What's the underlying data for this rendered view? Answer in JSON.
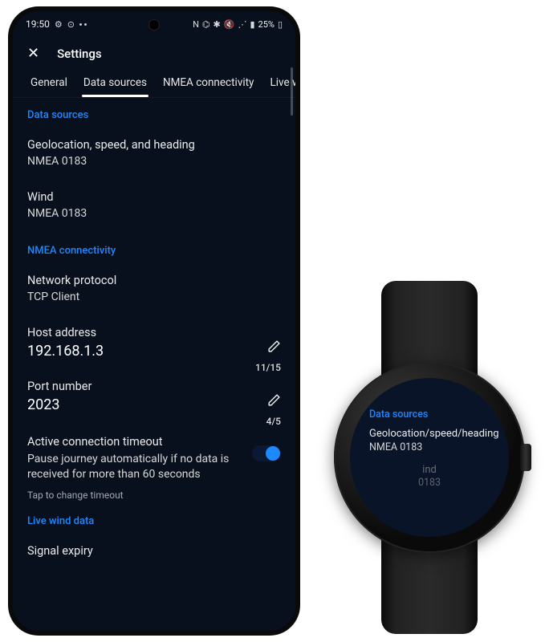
{
  "phone": {
    "statusbar": {
      "time": "19:50",
      "battery_text": "25%"
    },
    "appbar": {
      "title": "Settings"
    },
    "tabs": {
      "items": [
        {
          "label": "General"
        },
        {
          "label": "Data sources"
        },
        {
          "label": "NMEA connectivity"
        },
        {
          "label": "Live wir"
        }
      ],
      "active_index": 1
    },
    "sections": {
      "data_sources": {
        "header": "Data sources",
        "geo": {
          "title": "Geolocation, speed, and heading",
          "value": "NMEA 0183"
        },
        "wind": {
          "title": "Wind",
          "value": "NMEA 0183"
        }
      },
      "nmea": {
        "header": "NMEA connectivity",
        "protocol": {
          "title": "Network protocol",
          "value": "TCP Client"
        },
        "host": {
          "title": "Host address",
          "value": "192.168.1.3",
          "counter": "11/15"
        },
        "port": {
          "title": "Port number",
          "value": "2023",
          "counter": "4/5"
        },
        "timeout": {
          "title": "Active connection timeout",
          "desc": "Pause journey automatically if no data is received for more than 60 seconds",
          "hint": "Tap to change timeout",
          "on": true
        }
      },
      "live_wind": {
        "header": "Live wind data",
        "signal_expiry": {
          "title": "Signal expiry"
        }
      }
    }
  },
  "watch": {
    "sections": {
      "data_sources": {
        "header": "Data sources",
        "geo": {
          "title": "Geolocation/speed/heading",
          "value": "NMEA 0183"
        },
        "wind": {
          "title_partial": "ind",
          "value_partial": "0183"
        }
      }
    }
  },
  "colors": {
    "accent": "#1e88ff"
  }
}
